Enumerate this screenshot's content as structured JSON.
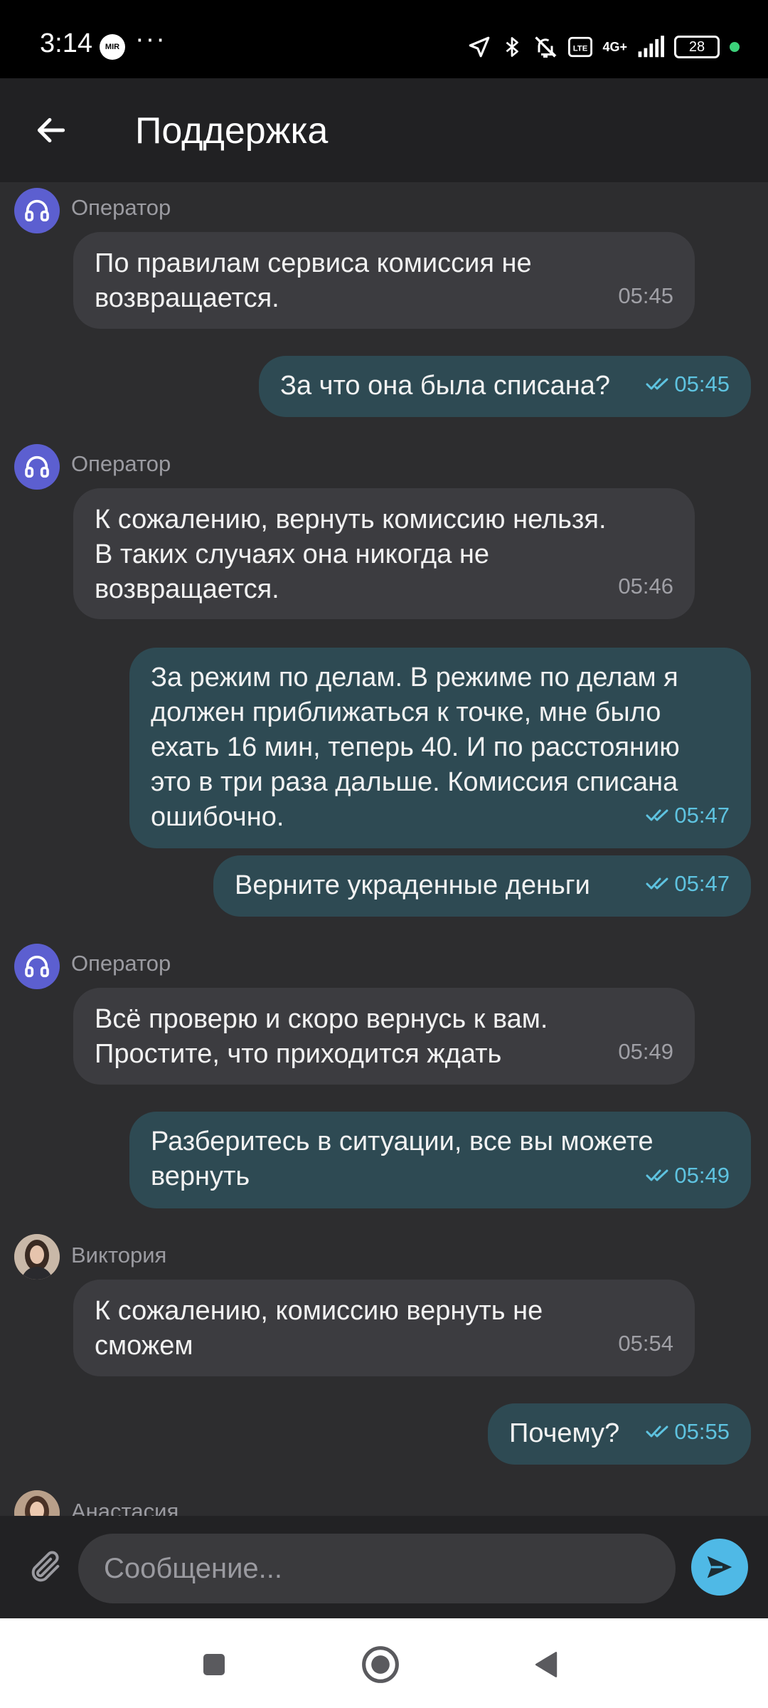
{
  "status_bar": {
    "time": "3:14",
    "mir": "MIR",
    "dots": "···",
    "network": "4G+",
    "battery": "28"
  },
  "header": {
    "title": "Поддержка"
  },
  "messages": [
    {
      "sender": "Оператор",
      "text": "По правилам сервиса комиссия не\nвозвращается.",
      "time": "05:45"
    },
    {
      "text": "За что она была списана?",
      "time": "05:45"
    },
    {
      "sender": "Оператор",
      "text": "К сожалению, вернуть комиссию нельзя.\nВ таких случаях она никогда не\nвозвращается.",
      "time": "05:46"
    },
    {
      "text": "За режим по делам. В режиме по делам я\nдолжен приближаться к точке, мне было\nехать 16 мин, теперь 40. И по расстоянию\nэто в три раза дальше. Комиссия списана\nошибочно.",
      "time": "05:47"
    },
    {
      "text": "Верните украденные деньги",
      "time": "05:47"
    },
    {
      "sender": "Оператор",
      "text": "Всё проверю и скоро вернусь к вам.\nПростите, что приходится ждать",
      "time": "05:49"
    },
    {
      "text": "Разберитесь в ситуации, все вы можете\nвернуть",
      "time": "05:49"
    },
    {
      "sender": "Виктория",
      "text": "К сожалению, комиссию вернуть не\nсможем",
      "time": "05:54"
    },
    {
      "text": "Почему?",
      "time": "05:55"
    },
    {
      "sender": "Анастасия"
    }
  ],
  "input": {
    "placeholder": "Сообщение..."
  },
  "colors": {
    "accent": "#4fb9e6",
    "outgoing_bubble": "#2e4a53",
    "incoming_bubble": "#3c3c40",
    "operator_avatar": "#5c5fd0"
  }
}
